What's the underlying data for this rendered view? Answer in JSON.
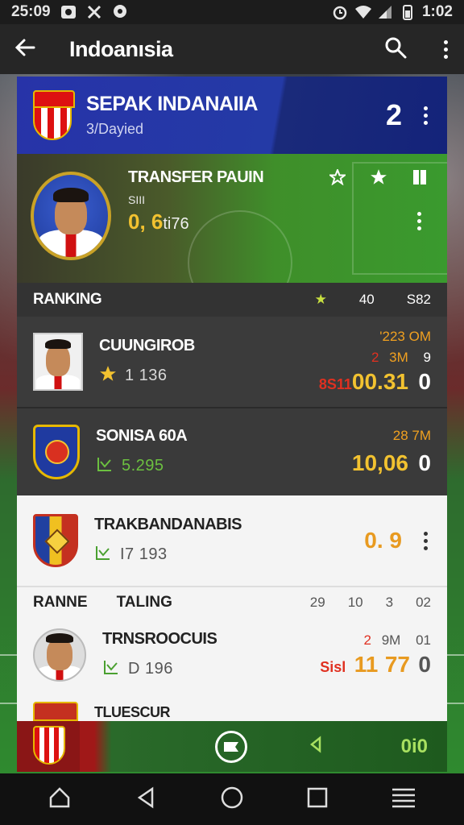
{
  "status_bar": {
    "time": "25:09",
    "clock": "1:02",
    "icons": [
      "image-icon",
      "tools-icon",
      "location-icon",
      "alarm-icon",
      "wifi-icon",
      "signal-icon",
      "battery-icon"
    ]
  },
  "app_bar": {
    "title": "Indoanısia",
    "back_icon": "back-arrow-icon",
    "search_icon": "search-icon",
    "menu_icon": "more-vert-icon"
  },
  "header_card": {
    "team_name": "SEPAK INDANAIIA",
    "subtitle": "3/Dayied",
    "count": "2"
  },
  "transfer_card": {
    "label": "TRANSFER  PAUIN",
    "mini": "SIII",
    "value_main": "0, 6",
    "value_suffix": "ti76"
  },
  "ranking": {
    "title": "RANKING",
    "col_star": "★",
    "col_1": "40",
    "col_2": "S82",
    "rows": [
      {
        "name": "CUUNGIROB",
        "stat_value": "1 136",
        "line1": "'223  OM",
        "line2_a": "2",
        "line2_b": "3M",
        "line2_c": "9",
        "price_prefix": "8S11",
        "price_main": "00.31",
        "price_end": "0"
      },
      {
        "name": "SONISA 60A",
        "stat_value": "5.295",
        "line1": "28  7M",
        "price_main": "10,06",
        "price_end": "0"
      }
    ]
  },
  "light_rows": [
    {
      "name": "TRAKBANDANABIS",
      "stat_value": "I7 193",
      "price_main": "0. 9"
    }
  ],
  "sub_section": {
    "left": "RANNE",
    "right": "TALING",
    "cols": [
      "29",
      "10",
      "3",
      "02"
    ]
  },
  "player_row": {
    "name": "TRNSROOCUIS",
    "stat_value": "D 196",
    "line1_a": "2",
    "line1_b": "9M",
    "line1_c": "01",
    "price_prefix": "Sisl",
    "price_main": "11",
    "price_mid": "77",
    "price_end": "0"
  },
  "partial_row": {
    "name": "TLUESCUR"
  },
  "bottom_bar": {
    "score": "0i0"
  },
  "colors": {
    "header_blue": "#2733a8",
    "pitch_green": "#3a9a2e",
    "dark_panel": "#3a3a3a",
    "accent_yellow": "#f2c230",
    "accent_orange": "#f0a020",
    "accent_red": "#e03020",
    "stat_green": "#6cc040"
  }
}
